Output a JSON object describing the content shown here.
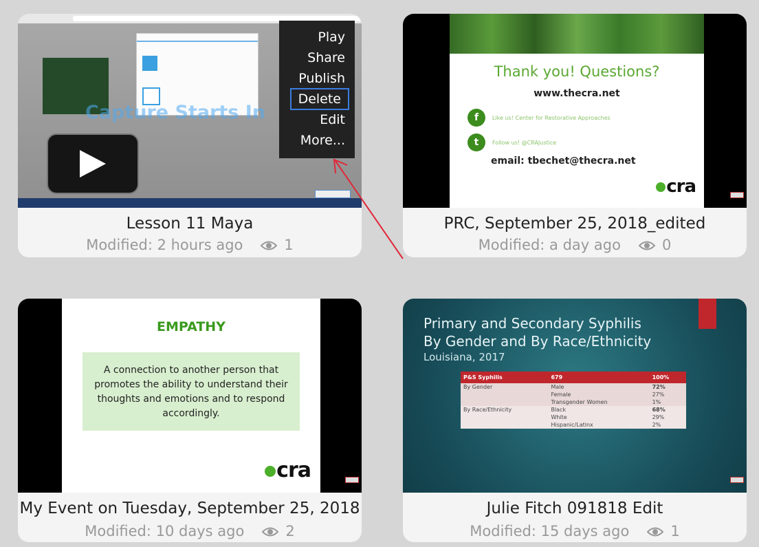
{
  "cards": [
    {
      "title": "Lesson 11 Maya",
      "modified": "Modified: 2 hours ago",
      "views": "1",
      "thumbnail_text": "Capture Starts In"
    },
    {
      "title": "PRC, September 25, 2018_edited",
      "modified": "Modified: a day ago",
      "views": "0",
      "slide": {
        "heading": "Thank you! Questions?",
        "website": "www.thecra.net",
        "facebook": "Like us! Center for Restorative Approaches",
        "twitter": "Follow us! @CRAJustice",
        "email": "email: tbechet@thecra.net",
        "logo": "cra"
      }
    },
    {
      "title": "My Event on Tuesday, September 25, 2018",
      "modified": "Modified: 10 days ago",
      "views": "2",
      "slide": {
        "heading": "EMPATHY",
        "body": "A connection to another person that promotes the ability to understand their thoughts and emotions and to respond accordingly.",
        "logo": "cra"
      }
    },
    {
      "title": "Julie Fitch 091818 Edit",
      "modified": "Modified: 15 days ago",
      "views": "1",
      "slide": {
        "title_line1": "Primary and Secondary Syphilis",
        "title_line2": "By Gender and By Race/Ethnicity",
        "subtitle": "Louisiana, 2017",
        "table_header": [
          "P&S Syphilis",
          "679",
          "100%"
        ],
        "rows": [
          {
            "group": "By Gender",
            "items": [
              "Male",
              "Female",
              "Transgender Women"
            ],
            "pcts": [
              "72%",
              "27%",
              "1%"
            ]
          },
          {
            "group": "By Race/Ethnicity",
            "items": [
              "Black",
              "White",
              "Hispanic/Latinx"
            ],
            "pcts": [
              "68%",
              "29%",
              "2%"
            ]
          }
        ]
      }
    }
  ],
  "context_menu": {
    "items": [
      "Play",
      "Share",
      "Publish",
      "Delete",
      "Edit",
      "More..."
    ],
    "focused": "Delete"
  },
  "icons": {
    "play": "play-icon",
    "eye": "eye-icon",
    "annotation": "red-arrow"
  },
  "colors": {
    "focus_border": "#3b7de0",
    "annotation_arrow": "#e0283a",
    "brand_green": "#4caf2a"
  }
}
